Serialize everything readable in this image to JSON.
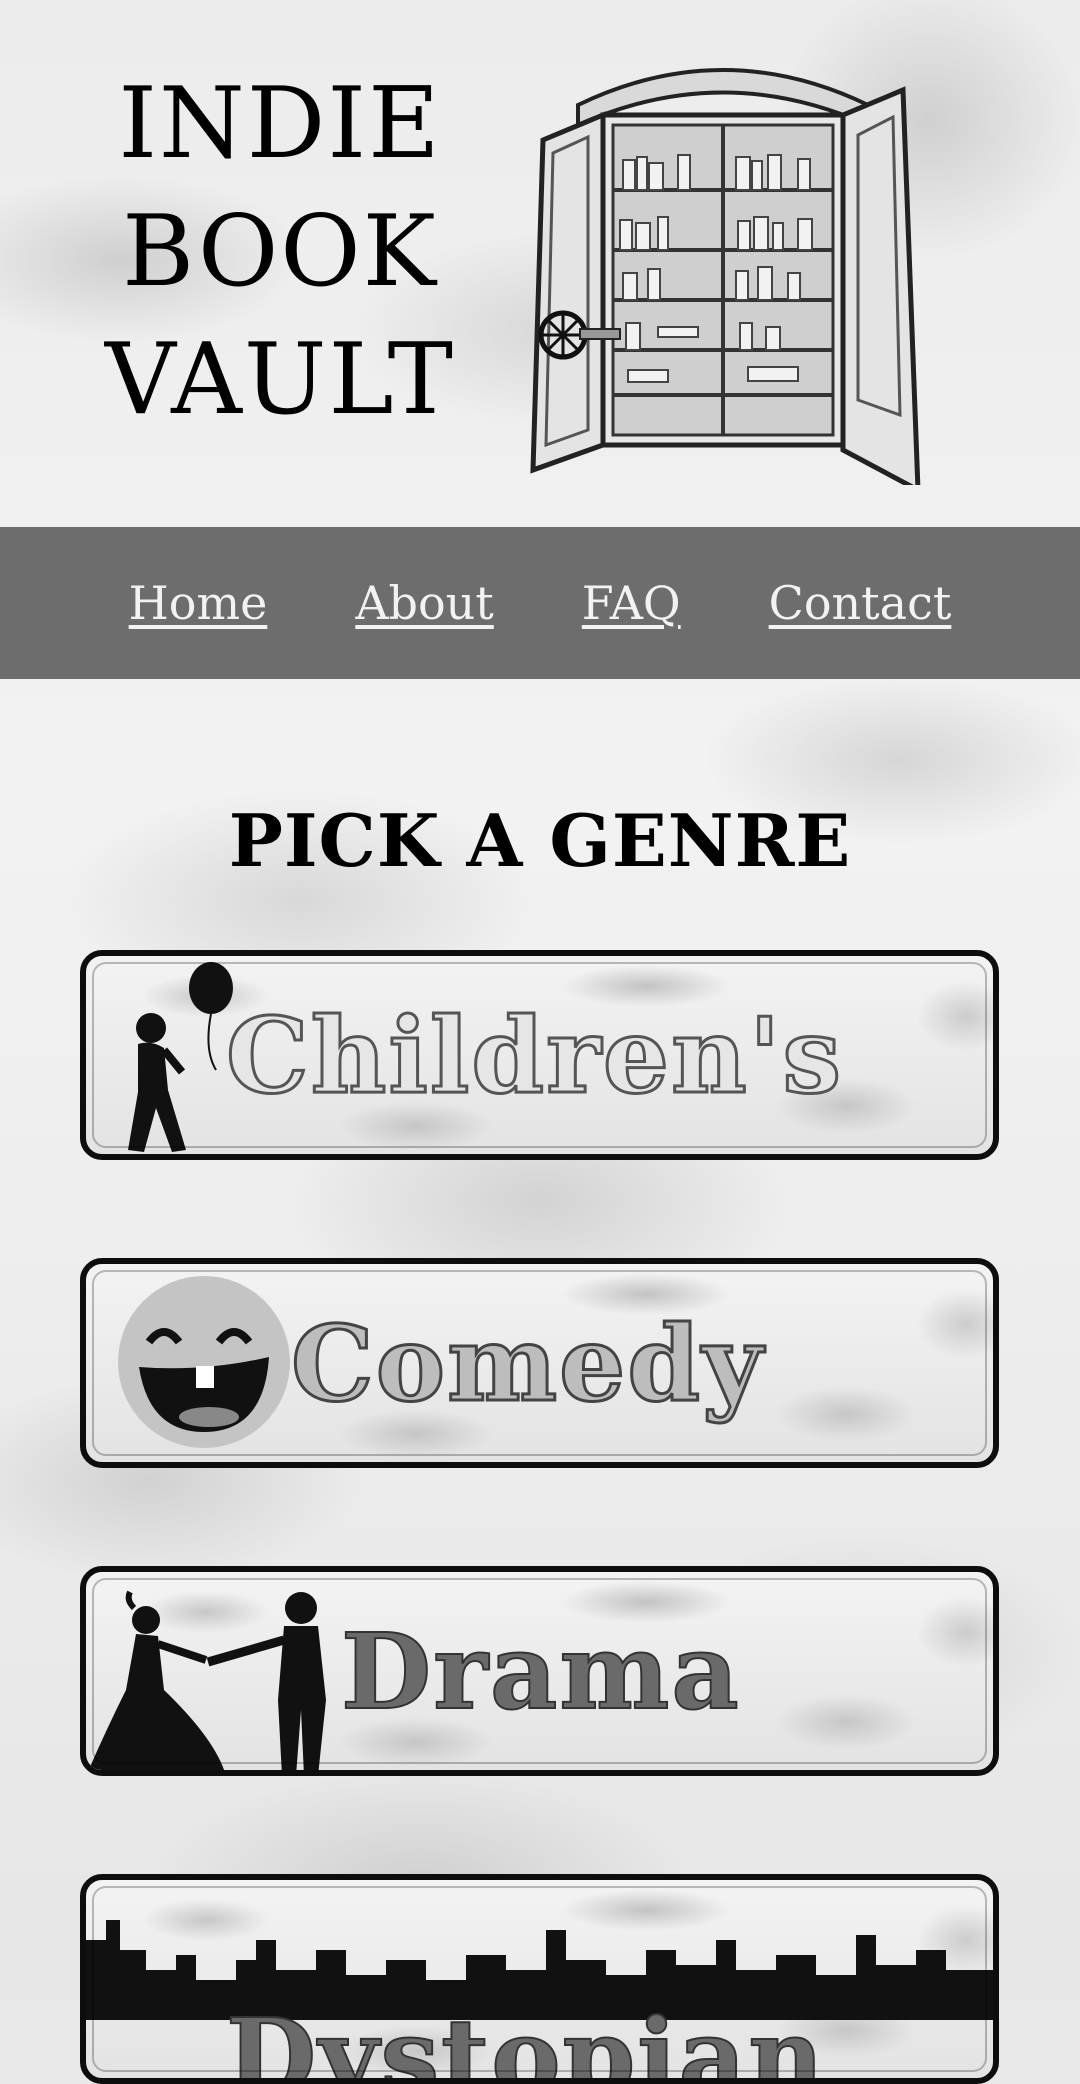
{
  "header": {
    "logo_lines": [
      "INDIE",
      "BOOK",
      "VAULT"
    ]
  },
  "nav": {
    "items": [
      {
        "label": "Home"
      },
      {
        "label": "About"
      },
      {
        "label": "FAQ"
      },
      {
        "label": "Contact"
      }
    ]
  },
  "main": {
    "section_title": "PICK A GENRE",
    "genres": [
      {
        "label": "Children's",
        "icon": "child-with-balloon-icon"
      },
      {
        "label": "Comedy",
        "icon": "laughing-face-icon"
      },
      {
        "label": "Drama",
        "icon": "dancing-couple-icon"
      },
      {
        "label": "Dystopian",
        "icon": "city-skyline-icon"
      }
    ]
  },
  "colors": {
    "nav_bg": "#6d6d6d",
    "nav_text": "#f2f2f2",
    "title_text": "#000000",
    "button_border": "#0d0d0d"
  }
}
